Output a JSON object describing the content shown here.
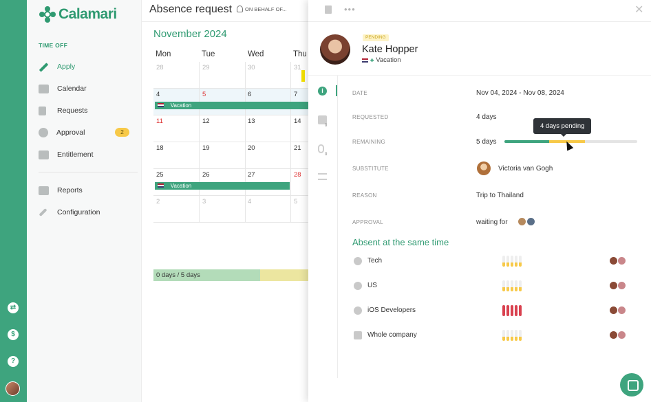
{
  "app": {
    "name": "Calamari"
  },
  "sidebar": {
    "section": "TIME OFF",
    "items": [
      {
        "label": "Apply",
        "icon": "pencil-icon",
        "active": true
      },
      {
        "label": "Calendar",
        "icon": "calendar-icon"
      },
      {
        "label": "Requests",
        "icon": "document-icon"
      },
      {
        "label": "Approval",
        "icon": "check-circle-icon",
        "badge": "2"
      },
      {
        "label": "Entitlement",
        "icon": "bar-chart-icon"
      },
      {
        "label": "Reports",
        "icon": "folder-icon"
      },
      {
        "label": "Configuration",
        "icon": "wrench-icon"
      }
    ]
  },
  "main": {
    "title": "Absence request",
    "on_behalf": "ON BEHALF OF...",
    "month": "November 2024",
    "days": [
      "Mon",
      "Tue",
      "Wed",
      "Thu"
    ],
    "weeks": [
      [
        "28",
        "29",
        "30",
        "31"
      ],
      [
        "4",
        "5",
        "6",
        "7"
      ],
      [
        "11",
        "12",
        "13",
        "14"
      ],
      [
        "18",
        "19",
        "20",
        "21"
      ],
      [
        "25",
        "26",
        "27",
        "28"
      ],
      [
        "2",
        "3",
        "4",
        "5"
      ]
    ],
    "vacation_label": "Vacation",
    "balance": "0 days / 5 days"
  },
  "drawer": {
    "status": "PENDING",
    "name": "Kate Hopper",
    "type": "Vacation",
    "fields": {
      "date_label": "DATE",
      "date_value": "Nov 04, 2024 - Nov 08, 2024",
      "requested_label": "REQUESTED",
      "requested_value": "4 days",
      "remaining_label": "REMAINING",
      "remaining_value": "5 days",
      "substitute_label": "SUBSTITUTE",
      "substitute_value": "Victoria van Gogh",
      "reason_label": "REASON",
      "reason_value": "Trip to Thailand",
      "approval_label": "APPROVAL",
      "approval_value": "waiting for"
    },
    "tooltip": "4 days pending",
    "tabs_counts": {
      "comments": "0",
      "attachments": "0"
    },
    "absent_title": "Absent at the same time",
    "teams": [
      {
        "name": "Tech",
        "icon": "team-icon",
        "status": "pending"
      },
      {
        "name": "US",
        "icon": "team-icon",
        "status": "pending"
      },
      {
        "name": "iOS Developers",
        "icon": "team-icon",
        "status": "conflict"
      },
      {
        "name": "Whole company",
        "icon": "building-icon",
        "status": "pending"
      }
    ]
  },
  "colors": {
    "brand": "#3ea47e",
    "pending": "#f7c948",
    "conflict": "#d9414f"
  }
}
